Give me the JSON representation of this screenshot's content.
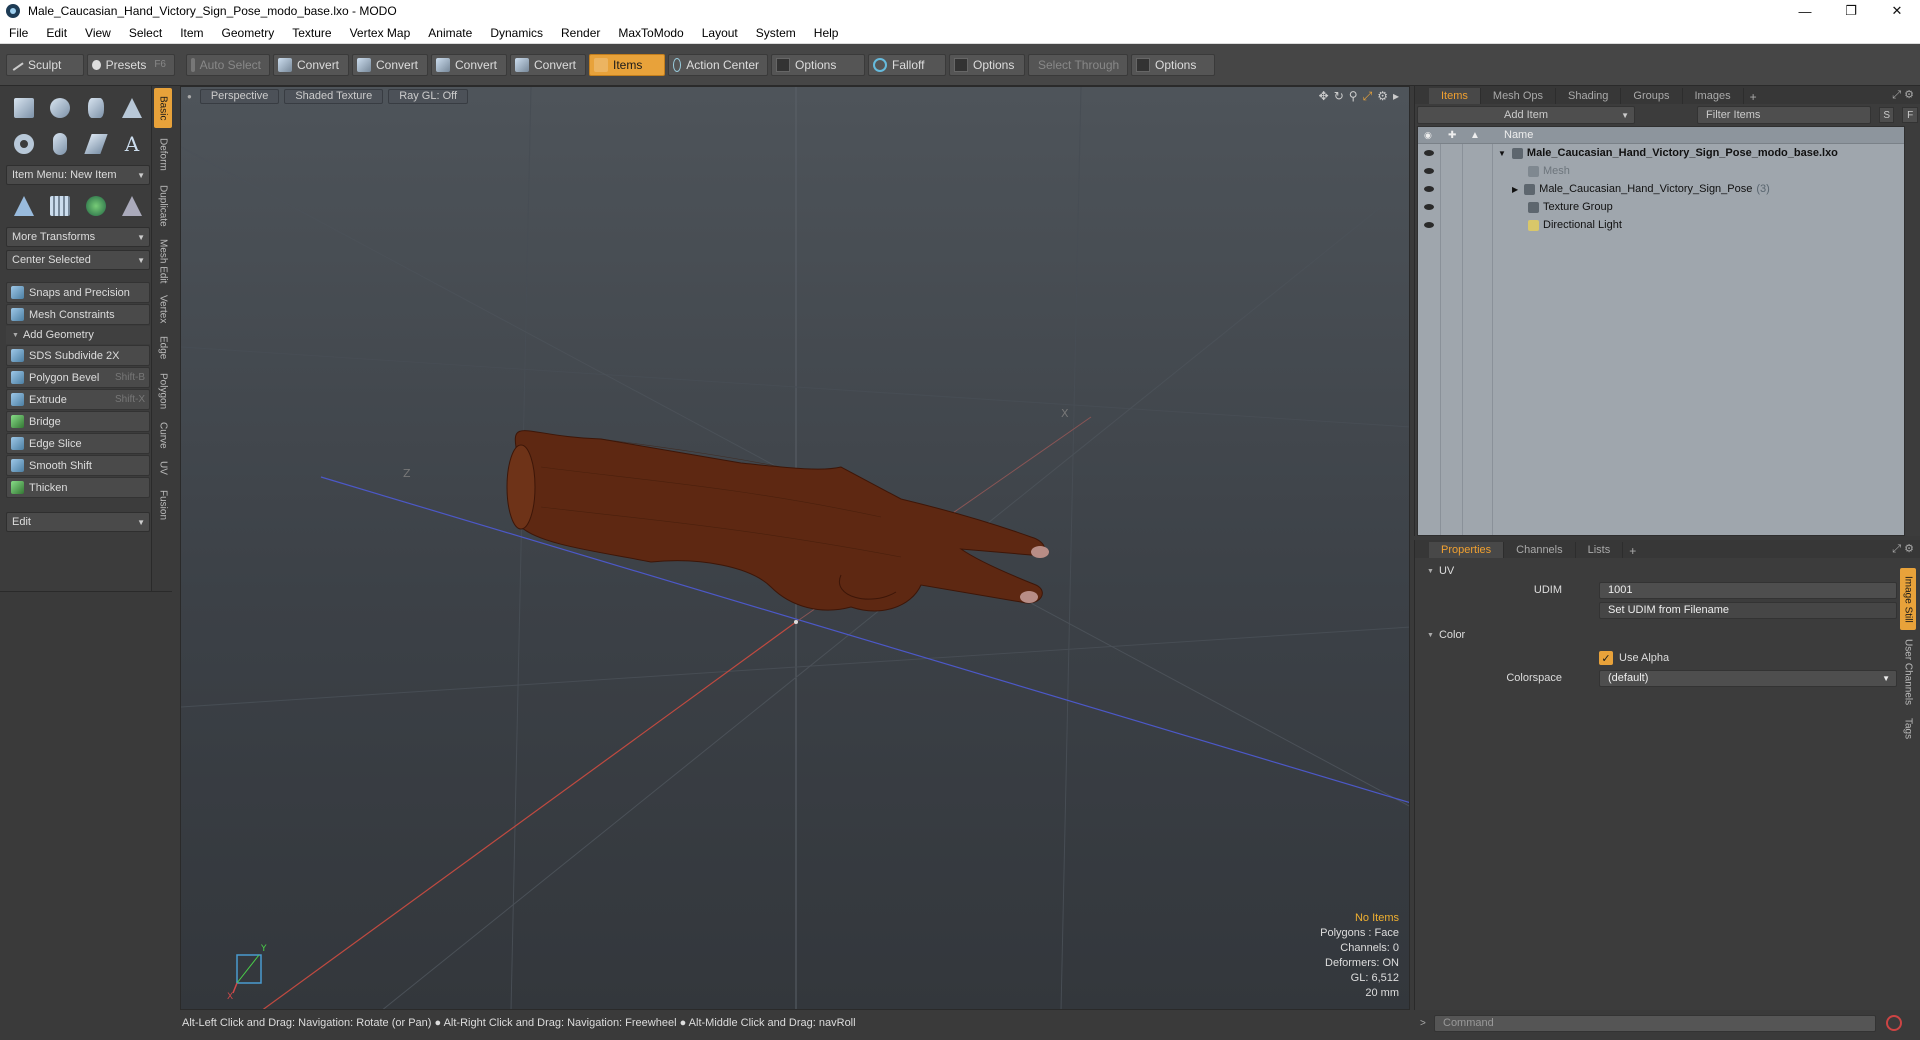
{
  "window": {
    "title": "Male_Caucasian_Hand_Victory_Sign_Pose_modo_base.lxo - MODO",
    "controls": [
      "—",
      "❐",
      "✕"
    ]
  },
  "menu": [
    "File",
    "Edit",
    "View",
    "Select",
    "Item",
    "Geometry",
    "Texture",
    "Vertex Map",
    "Animate",
    "Dynamics",
    "Render",
    "MaxToModo",
    "Layout",
    "System",
    "Help"
  ],
  "toolbar": {
    "sculpt": "Sculpt",
    "presets": "Presets",
    "presets_key": "F6",
    "auto_select": "Auto Select",
    "convert1": "Convert",
    "convert2": "Convert",
    "convert3": "Convert",
    "convert4": "Convert",
    "items": "Items",
    "action_center": "Action Center",
    "options1": "Options",
    "falloff": "Falloff",
    "options2": "Options",
    "select_through": "Select Through",
    "options3": "Options"
  },
  "leftpanel": {
    "item_menu": "Item Menu: New Item",
    "more_transforms": "More Transforms",
    "center_selected": "Center Selected",
    "snaps": "Snaps and Precision",
    "mesh_constraints": "Mesh Constraints",
    "add_geometry": "Add Geometry",
    "tools": [
      {
        "label": "SDS Subdivide 2X",
        "key": ""
      },
      {
        "label": "Polygon Bevel",
        "key": "Shift-B"
      },
      {
        "label": "Extrude",
        "key": "Shift-X"
      },
      {
        "label": "Bridge",
        "key": ""
      },
      {
        "label": "Edge Slice",
        "key": ""
      },
      {
        "label": "Smooth Shift",
        "key": ""
      },
      {
        "label": "Thicken",
        "key": ""
      }
    ],
    "edit": "Edit",
    "vtabs": [
      "Basic",
      "Deform",
      "Duplicate",
      "Mesh Edit",
      "Vertex",
      "Edge",
      "Polygon",
      "Curve",
      "UV",
      "Fusion"
    ]
  },
  "viewport": {
    "view": "Perspective",
    "shading": "Shaded Texture",
    "raygl": "Ray GL: Off",
    "info": {
      "no_items": "No Items",
      "polygons": "Polygons : Face",
      "channels": "Channels: 0",
      "deformers": "Deformers: ON",
      "gl": "GL: 6,512",
      "scale": "20 mm"
    },
    "axis_x": "X",
    "axis_y": "Y",
    "axis_z": "Z"
  },
  "status": "Alt-Left Click and Drag: Navigation: Rotate (or Pan) ● Alt-Right Click and Drag: Navigation: Freewheel ● Alt-Middle Click and Drag: navRoll",
  "items_panel": {
    "tabs": [
      "Items",
      "Mesh Ops",
      "Shading",
      "Groups",
      "Images"
    ],
    "add_item": "Add Item",
    "filter": "Filter Items",
    "s_btn": "S",
    "f_btn": "F",
    "col_name": "Name",
    "rows": [
      {
        "label": "Male_Caucasian_Hand_Victory_Sign_Pose_modo_base.lxo",
        "count": ""
      },
      {
        "label": "Mesh",
        "count": ""
      },
      {
        "label": "Male_Caucasian_Hand_Victory_Sign_Pose",
        "count": "(3)"
      },
      {
        "label": "Texture Group",
        "count": ""
      },
      {
        "label": "Directional Light",
        "count": ""
      }
    ]
  },
  "properties_panel": {
    "tabs": [
      "Properties",
      "Channels",
      "Lists"
    ],
    "uv_section": "UV",
    "udim_label": "UDIM",
    "udim_value": "1001",
    "set_udim": "Set UDIM from Filename",
    "color_section": "Color",
    "use_alpha": "Use Alpha",
    "colorspace_label": "Colorspace",
    "colorspace_value": "(default)",
    "vtabs": [
      "Image Still",
      "User Channels",
      "Tags"
    ]
  },
  "command": {
    "placeholder": "Command"
  }
}
